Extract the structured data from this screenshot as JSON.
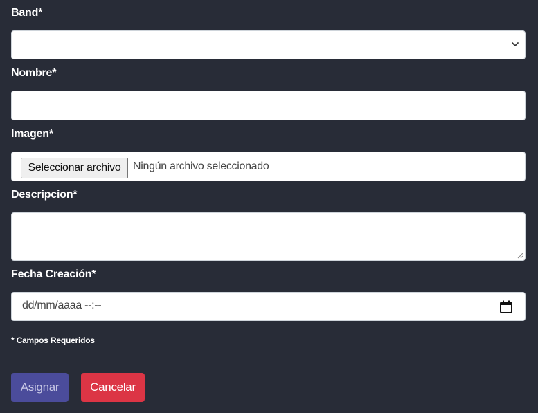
{
  "form": {
    "band": {
      "label": "Band*",
      "selected_value": ""
    },
    "nombre": {
      "label": "Nombre*",
      "value": ""
    },
    "imagen": {
      "label": "Imagen*",
      "button_label": "Seleccionar archivo",
      "status_text": "Ningún archivo seleccionado"
    },
    "descripcion": {
      "label": "Descripcion*",
      "value": ""
    },
    "fecha": {
      "label": "Fecha Creación*",
      "placeholder": "dd/mm/aaaa  --:--"
    },
    "required_note": "* Campos Requeridos"
  },
  "actions": {
    "assign_label": "Asignar",
    "cancel_label": "Cancelar"
  },
  "colors": {
    "background": "#282c37",
    "assign_button": "#4b4c9b",
    "cancel_button": "#dc3545",
    "field_background": "#ffffff"
  },
  "icons": {
    "select": "chevron-down-icon",
    "textarea": "resize-handle-icon",
    "date": "calendar-icon"
  }
}
